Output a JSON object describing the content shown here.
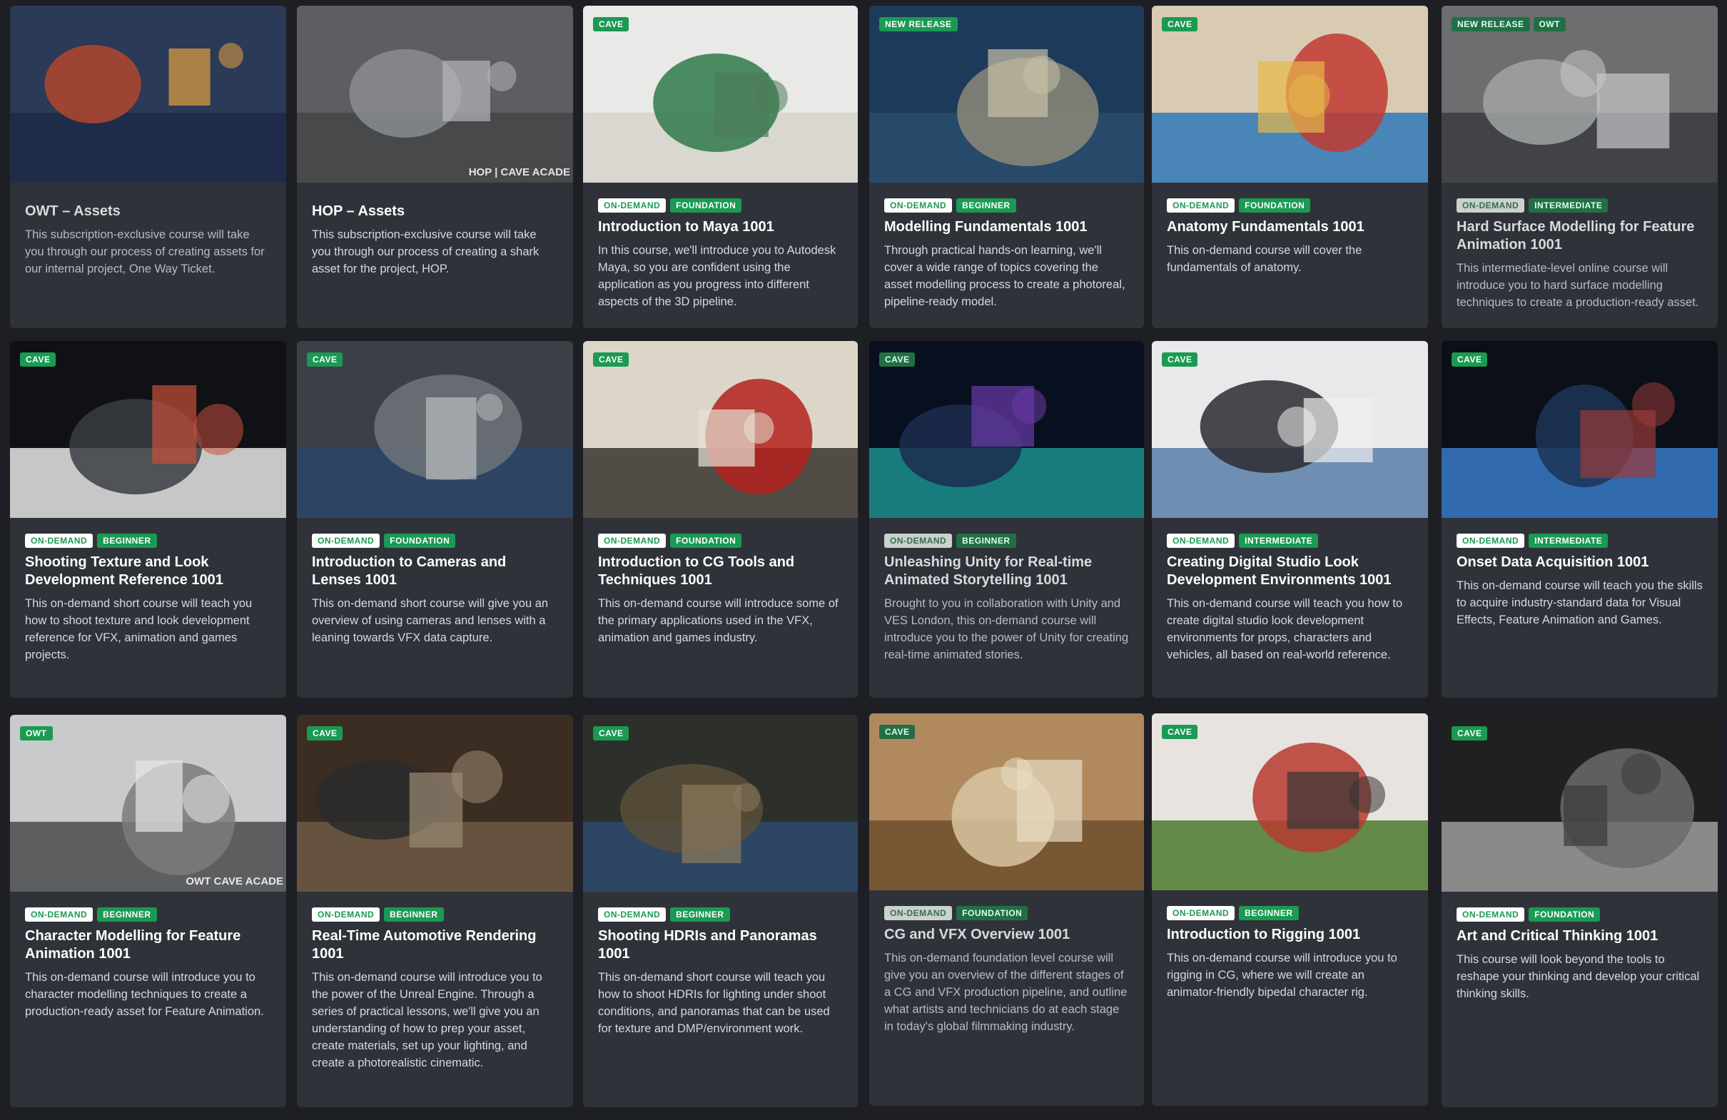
{
  "courses": [
    {
      "thumb_badges": [],
      "tags": [],
      "title": "OWT – Assets",
      "description": "This subscription-exclusive course will take you through our process of creating assets for our internal project, One Way Ticket.",
      "dim": true
    },
    {
      "thumb_badges": [],
      "tags": [],
      "title": "HOP – Assets",
      "description": "This subscription-exclusive course will take you through our process of creating a shark asset for the project, HOP.",
      "dim": false,
      "watermark": "HOP | CAVE ACADE"
    },
    {
      "thumb_badges": [
        "CAVE"
      ],
      "tags": [
        "ON-DEMAND",
        "FOUNDATION"
      ],
      "title": "Introduction to Maya 1001",
      "description": "In this course, we'll introduce you to Autodesk Maya, so you are confident using the application as you progress into different aspects of the 3D pipeline.",
      "dim": false
    },
    {
      "thumb_badges": [
        "NEW RELEASE"
      ],
      "tags": [
        "ON-DEMAND",
        "BEGINNER"
      ],
      "title": "Modelling Fundamentals 1001",
      "description": "Through practical hands-on learning, we'll cover a wide range of topics covering the asset modelling process to create a photoreal, pipeline-ready model.",
      "dim": false
    },
    {
      "thumb_badges": [
        "CAVE"
      ],
      "tags": [
        "ON-DEMAND",
        "FOUNDATION"
      ],
      "title": "Anatomy Fundamentals 1001",
      "description": "This on-demand course will cover the fundamentals of anatomy.",
      "dim": false
    },
    {
      "thumb_badges": [
        "NEW RELEASE",
        "OWT"
      ],
      "tags": [
        "ON-DEMAND",
        "INTERMEDIATE"
      ],
      "title": "Hard Surface Modelling for Feature Animation 1001",
      "description": "This intermediate-level online course will introduce you to hard surface modelling techniques to create a production-ready asset.",
      "dim": true
    },
    {
      "thumb_badges": [
        "CAVE"
      ],
      "tags": [
        "ON-DEMAND",
        "BEGINNER"
      ],
      "title": "Shooting Texture and Look Development Reference 1001",
      "description": "This on-demand short course will teach you how to shoot texture and look development reference for VFX, animation and games projects.",
      "dim": false
    },
    {
      "thumb_badges": [
        "CAVE"
      ],
      "tags": [
        "ON-DEMAND",
        "FOUNDATION"
      ],
      "title": "Introduction to Cameras and Lenses 1001",
      "description": "This on-demand short course will give you an overview of using cameras and lenses with a leaning towards VFX data capture.",
      "dim": false
    },
    {
      "thumb_badges": [
        "CAVE"
      ],
      "tags": [
        "ON-DEMAND",
        "FOUNDATION"
      ],
      "title": "Introduction to CG Tools and Techniques 1001",
      "description": "This on-demand course will introduce some of the primary applications used in the VFX, animation and games industry.",
      "dim": false
    },
    {
      "thumb_badges": [
        "CAVE"
      ],
      "tags": [
        "ON-DEMAND",
        "BEGINNER"
      ],
      "title": "Unleashing Unity for Real-time Animated Storytelling 1001",
      "description": "Brought to you in collaboration with Unity and VES London, this on-demand course will introduce you to the power of Unity for creating real-time animated stories.",
      "dim": true
    },
    {
      "thumb_badges": [
        "CAVE"
      ],
      "tags": [
        "ON-DEMAND",
        "INTERMEDIATE"
      ],
      "title": "Creating Digital Studio Look Development Environments 1001",
      "description": "This on-demand course will teach you how to create digital studio look development environments for props, characters and vehicles, all based on real-world reference.",
      "dim": false
    },
    {
      "thumb_badges": [
        "CAVE"
      ],
      "tags": [
        "ON-DEMAND",
        "INTERMEDIATE"
      ],
      "title": "Onset Data Acquisition 1001",
      "description": "This on-demand course will teach you the skills to acquire industry-standard data for Visual Effects, Feature Animation and Games.",
      "dim": false
    },
    {
      "thumb_badges": [
        "OWT"
      ],
      "tags": [
        "ON-DEMAND",
        "BEGINNER"
      ],
      "title": "Character Modelling for Feature Animation 1001",
      "description": "This on-demand course will introduce you to character modelling techniques to create a production-ready asset for Feature Animation.",
      "dim": false,
      "watermark": "OWT CAVE ACADE"
    },
    {
      "thumb_badges": [
        "CAVE"
      ],
      "tags": [
        "ON-DEMAND",
        "BEGINNER"
      ],
      "title": "Real-Time Automotive Rendering 1001",
      "description": "This on-demand course will introduce you to the power of the Unreal Engine. Through a series of practical lessons, we'll give you an understanding of how to prep your asset, create materials, set up your lighting, and create a photorealistic cinematic.",
      "dim": false
    },
    {
      "thumb_badges": [
        "CAVE"
      ],
      "tags": [
        "ON-DEMAND",
        "BEGINNER"
      ],
      "title": "Shooting HDRIs and Panoramas 1001",
      "description": "This on-demand short course will teach you how to shoot HDRIs for lighting under shoot conditions, and panoramas that can be used for texture and DMP/environment work.",
      "dim": false
    },
    {
      "thumb_badges": [
        "CAVE"
      ],
      "tags": [
        "ON-DEMAND",
        "FOUNDATION"
      ],
      "title": "CG and VFX Overview 1001",
      "description": "This on-demand foundation level course will give you an overview of the different stages of a CG and VFX production pipeline, and outline what artists and technicians do at each stage in today's global filmmaking industry.",
      "dim": true
    },
    {
      "thumb_badges": [
        "CAVE"
      ],
      "tags": [
        "ON-DEMAND",
        "BEGINNER"
      ],
      "title": "Introduction to Rigging 1001",
      "description": "This on-demand course will introduce you to rigging in CG, where we will create an animator-friendly bipedal character rig.",
      "dim": false
    },
    {
      "thumb_badges": [
        "CAVE"
      ],
      "tags": [
        "ON-DEMAND",
        "FOUNDATION"
      ],
      "title": "Art and Critical Thinking 1001",
      "description": "This course will look beyond the tools to reshape your thinking and develop your critical thinking skills.",
      "dim": false
    }
  ]
}
